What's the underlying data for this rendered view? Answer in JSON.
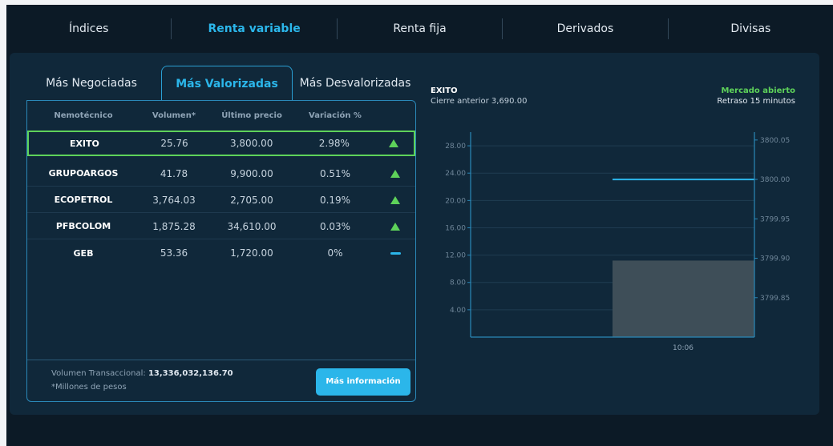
{
  "nav": {
    "items": [
      {
        "label": "Índices"
      },
      {
        "label": "Renta variable"
      },
      {
        "label": "Renta fija"
      },
      {
        "label": "Derivados"
      },
      {
        "label": "Divisas"
      }
    ]
  },
  "tabs": [
    {
      "label": "Más Negociadas"
    },
    {
      "label": "Más Valorizadas"
    },
    {
      "label": "Más Desvalorizadas"
    }
  ],
  "table": {
    "headers": [
      "Nemotécnico",
      "Volumen*",
      "Último precio",
      "Variación %"
    ],
    "rows": [
      {
        "ticker": "EXITO",
        "volume": "25.76",
        "price": "3,800.00",
        "change": "2.98%",
        "trend": "up"
      },
      {
        "ticker": "GRUPOARGOS",
        "volume": "41.78",
        "price": "9,900.00",
        "change": "0.51%",
        "trend": "up"
      },
      {
        "ticker": "ECOPETROL",
        "volume": "3,764.03",
        "price": "2,705.00",
        "change": "0.19%",
        "trend": "up"
      },
      {
        "ticker": "PFBCOLOM",
        "volume": "1,875.28",
        "price": "34,610.00",
        "change": "0.03%",
        "trend": "up"
      },
      {
        "ticker": "GEB",
        "volume": "53.36",
        "price": "1,720.00",
        "change": "0%",
        "trend": "flat"
      }
    ],
    "volume_label": "Volumen Transaccional:",
    "volume_value": "13,336,032,136.70",
    "note": "*Millones de pesos",
    "more_button": "Más información"
  },
  "chart_header": {
    "ticker": "EXITO",
    "previous_close": "Cierre anterior 3,690.00",
    "market_status": "Mercado abierto",
    "delay": "Retraso 15 minutos"
  },
  "colors": {
    "accent": "#2bb6ea",
    "positive": "#5ed25a",
    "background": "#0c1a26",
    "panel": "#10283a"
  },
  "chart_data": {
    "type": "bar",
    "x_ticks": [
      "10:06"
    ],
    "left_axis": {
      "ticks": [
        "28.00",
        "24.00",
        "20.00",
        "16.00",
        "12.00",
        "8.00",
        "4.00"
      ],
      "ylim": [
        0,
        30
      ]
    },
    "right_axis": {
      "ticks": [
        "3800.05",
        "3800.00",
        "3799.95",
        "3799.90",
        "3799.85"
      ],
      "ylim": [
        3799.8,
        3800.06
      ]
    },
    "volume_bar": {
      "x": "10:06",
      "value": 11.2
    },
    "price_line": {
      "from": "10:06",
      "value": 3800.0
    },
    "grid": true
  }
}
